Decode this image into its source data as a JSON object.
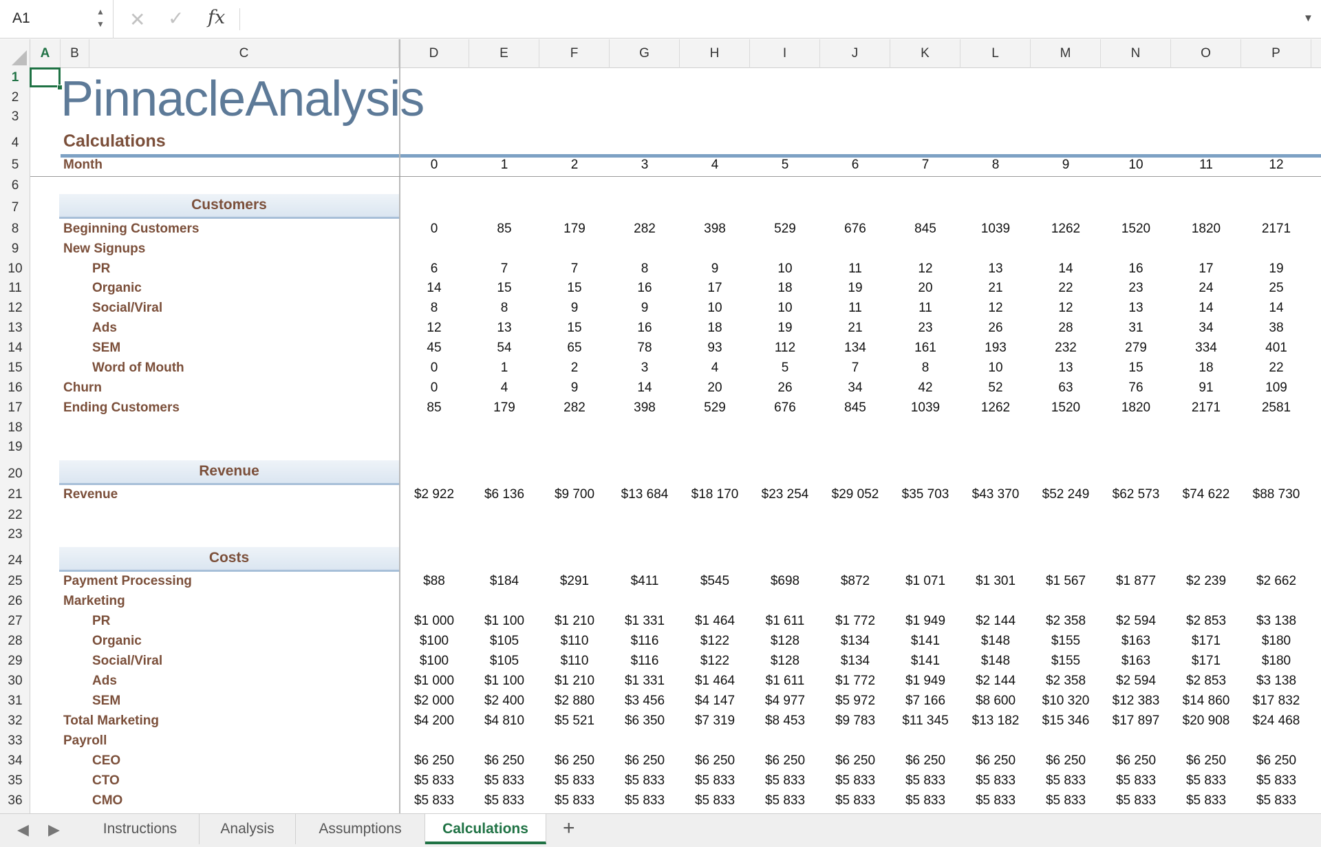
{
  "formula_bar": {
    "name_box": "A1",
    "fx_label": "fx",
    "cancel_glyph": "✕",
    "confirm_glyph": "✓",
    "formula": ""
  },
  "columns": [
    "A",
    "B",
    "C",
    "D",
    "E",
    "F",
    "G",
    "H",
    "I",
    "J",
    "K",
    "L",
    "M",
    "N",
    "O",
    "P"
  ],
  "rows": [
    "1",
    "2",
    "3",
    "4",
    "5",
    "6",
    "7",
    "8",
    "9",
    "10",
    "11",
    "12",
    "13",
    "14",
    "15",
    "16",
    "17",
    "18",
    "19",
    "20",
    "21",
    "22",
    "23",
    "24",
    "25",
    "26",
    "27",
    "28",
    "29",
    "30",
    "31",
    "32",
    "33",
    "34",
    "35",
    "36"
  ],
  "logo": "PinnacleAnalysis",
  "title": "Calculations",
  "month_label": "Month",
  "months": [
    "0",
    "1",
    "2",
    "3",
    "4",
    "5",
    "6",
    "7",
    "8",
    "9",
    "10",
    "11",
    "12"
  ],
  "sections": {
    "customers": "Customers",
    "revenue": "Revenue",
    "costs": "Costs"
  },
  "customers_rows": [
    {
      "label": "Beginning Customers",
      "indent": false,
      "values": [
        "0",
        "85",
        "179",
        "282",
        "398",
        "529",
        "676",
        "845",
        "1039",
        "1262",
        "1520",
        "1820",
        "2171"
      ]
    },
    {
      "label": "New Signups",
      "indent": false,
      "values": []
    },
    {
      "label": "PR",
      "indent": true,
      "values": [
        "6",
        "7",
        "7",
        "8",
        "9",
        "10",
        "11",
        "12",
        "13",
        "14",
        "16",
        "17",
        "19"
      ]
    },
    {
      "label": "Organic",
      "indent": true,
      "values": [
        "14",
        "15",
        "15",
        "16",
        "17",
        "18",
        "19",
        "20",
        "21",
        "22",
        "23",
        "24",
        "25"
      ]
    },
    {
      "label": "Social/Viral",
      "indent": true,
      "values": [
        "8",
        "8",
        "9",
        "9",
        "10",
        "10",
        "11",
        "11",
        "12",
        "12",
        "13",
        "14",
        "14"
      ]
    },
    {
      "label": "Ads",
      "indent": true,
      "values": [
        "12",
        "13",
        "15",
        "16",
        "18",
        "19",
        "21",
        "23",
        "26",
        "28",
        "31",
        "34",
        "38"
      ]
    },
    {
      "label": "SEM",
      "indent": true,
      "values": [
        "45",
        "54",
        "65",
        "78",
        "93",
        "112",
        "134",
        "161",
        "193",
        "232",
        "279",
        "334",
        "401"
      ]
    },
    {
      "label": "Word of Mouth",
      "indent": true,
      "values": [
        "0",
        "1",
        "2",
        "3",
        "4",
        "5",
        "7",
        "8",
        "10",
        "13",
        "15",
        "18",
        "22"
      ]
    },
    {
      "label": "Churn",
      "indent": false,
      "values": [
        "0",
        "4",
        "9",
        "14",
        "20",
        "26",
        "34",
        "42",
        "52",
        "63",
        "76",
        "91",
        "109"
      ]
    },
    {
      "label": "Ending Customers",
      "indent": false,
      "values": [
        "85",
        "179",
        "282",
        "398",
        "529",
        "676",
        "845",
        "1039",
        "1262",
        "1520",
        "1820",
        "2171",
        "2581"
      ]
    }
  ],
  "revenue_row": {
    "label": "Revenue",
    "values": [
      "$2 922",
      "$6 136",
      "$9 700",
      "$13 684",
      "$18 170",
      "$23 254",
      "$29 052",
      "$35 703",
      "$43 370",
      "$52 249",
      "$62 573",
      "$74 622",
      "$88 730"
    ]
  },
  "costs_rows": [
    {
      "label": "Payment Processing",
      "indent": false,
      "values": [
        "$88",
        "$184",
        "$291",
        "$411",
        "$545",
        "$698",
        "$872",
        "$1 071",
        "$1 301",
        "$1 567",
        "$1 877",
        "$2 239",
        "$2 662"
      ]
    },
    {
      "label": "Marketing",
      "indent": false,
      "values": []
    },
    {
      "label": "PR",
      "indent": true,
      "values": [
        "$1 000",
        "$1 100",
        "$1 210",
        "$1 331",
        "$1 464",
        "$1 611",
        "$1 772",
        "$1 949",
        "$2 144",
        "$2 358",
        "$2 594",
        "$2 853",
        "$3 138"
      ]
    },
    {
      "label": "Organic",
      "indent": true,
      "values": [
        "$100",
        "$105",
        "$110",
        "$116",
        "$122",
        "$128",
        "$134",
        "$141",
        "$148",
        "$155",
        "$163",
        "$171",
        "$180"
      ]
    },
    {
      "label": "Social/Viral",
      "indent": true,
      "values": [
        "$100",
        "$105",
        "$110",
        "$116",
        "$122",
        "$128",
        "$134",
        "$141",
        "$148",
        "$155",
        "$163",
        "$171",
        "$180"
      ]
    },
    {
      "label": "Ads",
      "indent": true,
      "values": [
        "$1 000",
        "$1 100",
        "$1 210",
        "$1 331",
        "$1 464",
        "$1 611",
        "$1 772",
        "$1 949",
        "$2 144",
        "$2 358",
        "$2 594",
        "$2 853",
        "$3 138"
      ]
    },
    {
      "label": "SEM",
      "indent": true,
      "values": [
        "$2 000",
        "$2 400",
        "$2 880",
        "$3 456",
        "$4 147",
        "$4 977",
        "$5 972",
        "$7 166",
        "$8 600",
        "$10 320",
        "$12 383",
        "$14 860",
        "$17 832"
      ]
    },
    {
      "label": "Total Marketing",
      "indent": false,
      "values": [
        "$4 200",
        "$4 810",
        "$5 521",
        "$6 350",
        "$7 319",
        "$8 453",
        "$9 783",
        "$11 345",
        "$13 182",
        "$15 346",
        "$17 897",
        "$20 908",
        "$24 468"
      ]
    },
    {
      "label": "Payroll",
      "indent": false,
      "values": []
    },
    {
      "label": "CEO",
      "indent": true,
      "values": [
        "$6 250",
        "$6 250",
        "$6 250",
        "$6 250",
        "$6 250",
        "$6 250",
        "$6 250",
        "$6 250",
        "$6 250",
        "$6 250",
        "$6 250",
        "$6 250",
        "$6 250"
      ]
    },
    {
      "label": "CTO",
      "indent": true,
      "values": [
        "$5 833",
        "$5 833",
        "$5 833",
        "$5 833",
        "$5 833",
        "$5 833",
        "$5 833",
        "$5 833",
        "$5 833",
        "$5 833",
        "$5 833",
        "$5 833",
        "$5 833"
      ]
    },
    {
      "label": "CMO",
      "indent": true,
      "values": [
        "$5 833",
        "$5 833",
        "$5 833",
        "$5 833",
        "$5 833",
        "$5 833",
        "$5 833",
        "$5 833",
        "$5 833",
        "$5 833",
        "$5 833",
        "$5 833",
        "$5 833"
      ]
    }
  ],
  "tabs": [
    "Instructions",
    "Analysis",
    "Assumptions",
    "Calculations"
  ],
  "active_tab": "Calculations",
  "add_sheet_glyph": "+",
  "nav_prev_glyph": "◀",
  "nav_next_glyph": "▶",
  "colors": {
    "accent_green": "#1f7244",
    "label_brown": "#7b4f3a",
    "logo_blue": "#5d7a98",
    "rule_blue": "#7da1c4"
  }
}
